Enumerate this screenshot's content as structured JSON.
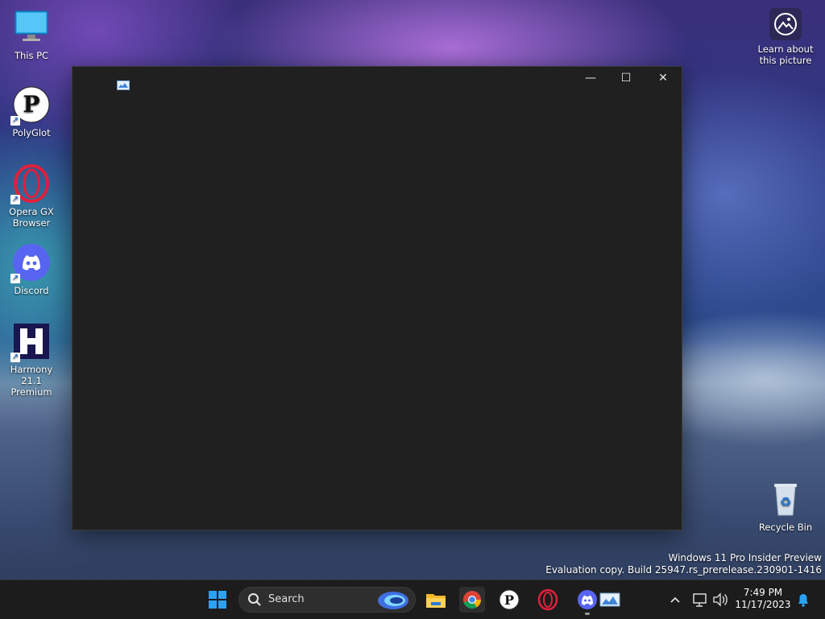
{
  "desktop": {
    "icons": [
      {
        "label": "This PC",
        "icon": "monitor-icon"
      },
      {
        "label": "PolyGlot",
        "icon": "polyglot-icon"
      },
      {
        "label": "Opera GX Browser",
        "icon": "opera-gx-icon"
      },
      {
        "label": "Discord",
        "icon": "discord-icon"
      },
      {
        "label": "Harmony 21.1 Premium",
        "icon": "harmony-icon"
      },
      {
        "label": "Recycle Bin",
        "icon": "recycle-bin-icon"
      }
    ],
    "learn_about": "Learn about this picture"
  },
  "window": {
    "app_icon": "image-viewer-icon",
    "minimize": "—",
    "maximize": "☐",
    "close": "✕"
  },
  "watermark": {
    "line1": "Windows 11 Pro Insider Preview",
    "line2": "Evaluation copy. Build 25947.rs_prerelease.230901-1416"
  },
  "taskbar": {
    "search_placeholder": "Search",
    "pinned": [
      "start-icon",
      "file-explorer-icon",
      "chrome-icon",
      "polyglot-icon",
      "opera-gx-icon",
      "discord-icon",
      "image-viewer-icon"
    ],
    "time": "7:49 PM",
    "date": "11/17/2023",
    "tray": [
      "chevron-up-icon",
      "network-icon",
      "volume-icon",
      "bell-icon"
    ]
  },
  "colors": {
    "taskbar_bg": "#1c1c1c",
    "window_bg": "#202020",
    "windows_blue": "#2aa3f5",
    "opera_red": "#e0203c",
    "discord_blurple": "#5865f2"
  }
}
